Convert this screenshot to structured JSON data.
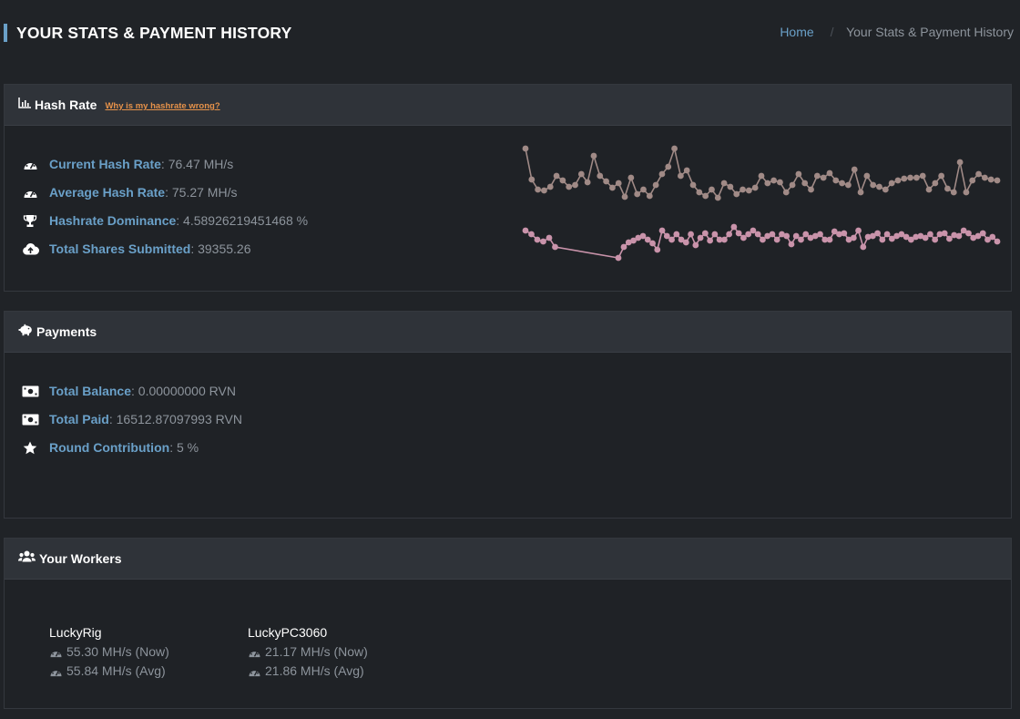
{
  "header": {
    "title": "YOUR STATS & PAYMENT HISTORY",
    "breadcrumb_home": "Home",
    "breadcrumb_sep": "/",
    "breadcrumb_current": "Your Stats & Payment History"
  },
  "hashrate": {
    "title": "Hash Rate",
    "help_link": "Why is my hashrate wrong?",
    "stats": [
      {
        "label": "Current Hash Rate",
        "value": ": 76.47 MH/s",
        "icon": "tachometer-icon"
      },
      {
        "label": "Average Hash Rate",
        "value": ": 75.27 MH/s",
        "icon": "tachometer-icon"
      },
      {
        "label": "Hashrate Dominance",
        "value": ": 4.58926219451468 %",
        "icon": "trophy-icon"
      },
      {
        "label": "Total Shares Submitted",
        "value": ": 39355.26",
        "icon": "cloud-upload-icon"
      }
    ],
    "sparkline_colors": {
      "hashrate": "#a08a86",
      "shares": "#c993aa"
    }
  },
  "payments": {
    "title": "Payments",
    "stats": [
      {
        "label": "Total Balance",
        "value": ": 0.00000000 RVN",
        "icon": "money-bill-icon"
      },
      {
        "label": "Total Paid",
        "value": ": 16512.87097993 RVN",
        "icon": "money-bill-icon"
      },
      {
        "label": "Round Contribution",
        "value": ": 5 %",
        "icon": "star-icon"
      }
    ]
  },
  "workers": {
    "title": "Your Workers",
    "items": [
      {
        "name": "LuckyRig",
        "now": "55.30 MH/s (Now)",
        "avg": "55.84 MH/s (Avg)"
      },
      {
        "name": "LuckyPC3060",
        "now": "21.17 MH/s (Now)",
        "avg": "21.86 MH/s (Avg)"
      }
    ]
  }
}
